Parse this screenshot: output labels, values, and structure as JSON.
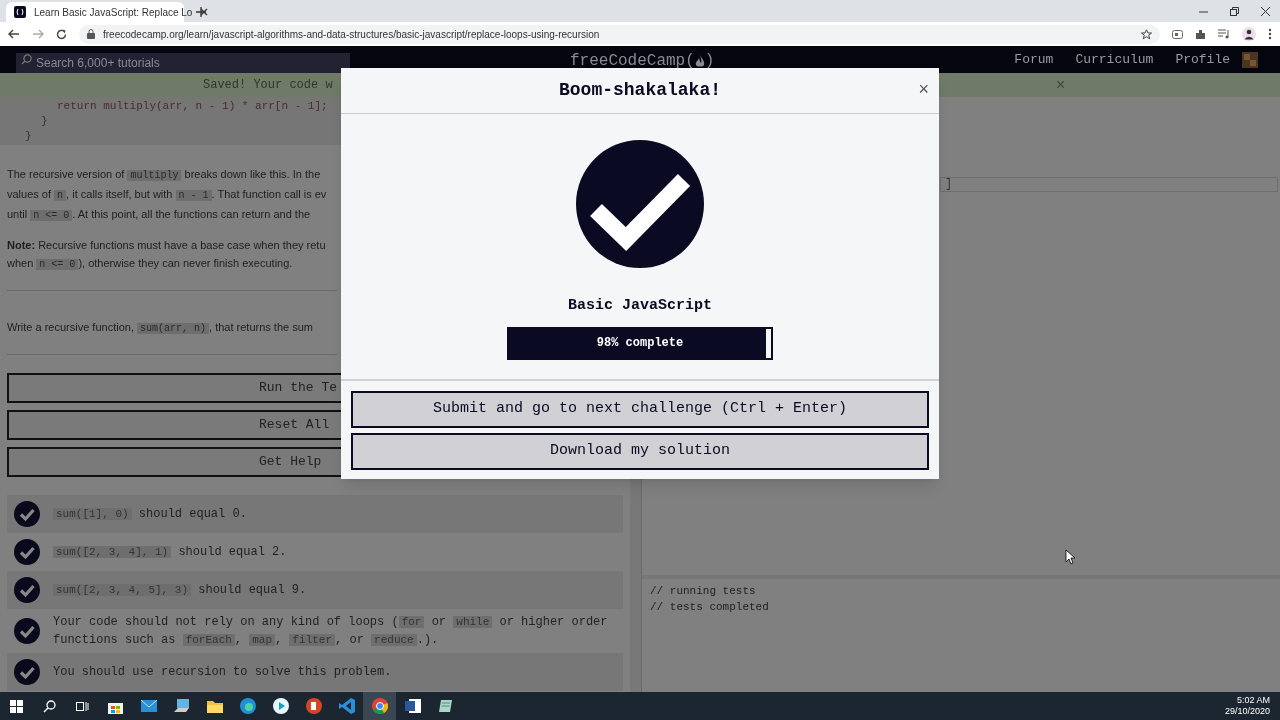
{
  "browser": {
    "tab_title": "Learn Basic JavaScript: Replace Lo",
    "url": "freecodecamp.org/learn/javascript-algorithms-and-data-structures/basic-javascript/replace-loops-using-recursion"
  },
  "navbar": {
    "search_placeholder": "Search 6,000+ tutorials",
    "logo": "freeCodeCamp",
    "logo_open": "(",
    "logo_close": ")",
    "links": [
      "Forum",
      "Curriculum",
      "Profile"
    ]
  },
  "banner": {
    "text": "Saved! Your code w",
    "close": "×"
  },
  "lesson": {
    "code_lines": [
      "return multiply(arr, n - 1) * arr[n - 1];",
      "}",
      "}"
    ],
    "paragraphs": [
      [
        [
          {
            "kind": "text",
            "text": "The recursive version of "
          },
          {
            "kind": "code",
            "text": "multiply"
          },
          {
            "kind": "text",
            "text": " breaks down like this. In the"
          }
        ],
        [
          {
            "kind": "text",
            "text": "values of "
          },
          {
            "kind": "code",
            "text": "n"
          },
          {
            "kind": "text",
            "text": ", it calls itself, but with "
          },
          {
            "kind": "code",
            "text": "n - 1"
          },
          {
            "kind": "text",
            "text": ". That function call is ev"
          }
        ],
        [
          {
            "kind": "text",
            "text": "until "
          },
          {
            "kind": "code",
            "text": "n <= 0"
          },
          {
            "kind": "text",
            "text": ". At this point, all the functions can return and the"
          }
        ]
      ],
      [
        [
          {
            "kind": "bold",
            "text": "Note:"
          },
          {
            "kind": "text",
            "text": " Recursive functions must have a base case when they retu"
          }
        ],
        [
          {
            "kind": "text",
            "text": "when "
          },
          {
            "kind": "code",
            "text": "n <= 0"
          },
          {
            "kind": "text",
            "text": "), otherwise they can never finish executing."
          }
        ]
      ],
      [
        [
          {
            "kind": "text",
            "text": "Write a recursive function, "
          },
          {
            "kind": "code",
            "text": "sum(arr, n)"
          },
          {
            "kind": "text",
            "text": ", that returns the sum"
          }
        ]
      ]
    ],
    "buttons": [
      "Run the Te",
      "Reset All",
      "Get Help"
    ],
    "tests": [
      {
        "passed": true,
        "parts": [
          {
            "kind": "code",
            "text": "sum([1], 0)"
          },
          {
            "kind": "text",
            "text": " should equal 0."
          }
        ]
      },
      {
        "passed": true,
        "parts": [
          {
            "kind": "code",
            "text": "sum([2, 3, 4], 1)"
          },
          {
            "kind": "text",
            "text": " should equal 2."
          }
        ]
      },
      {
        "passed": true,
        "parts": [
          {
            "kind": "code",
            "text": "sum([2, 3, 4, 5], 3)"
          },
          {
            "kind": "text",
            "text": " should equal 9."
          }
        ]
      },
      {
        "passed": true,
        "parts": [
          {
            "kind": "text",
            "text": "Your code should not rely on any kind of loops ("
          },
          {
            "kind": "code",
            "text": "for"
          },
          {
            "kind": "text",
            "text": " or "
          },
          {
            "kind": "code",
            "text": "while"
          },
          {
            "kind": "text",
            "text": " or higher order functions such as "
          },
          {
            "kind": "code",
            "text": "forEach"
          },
          {
            "kind": "text",
            "text": ", "
          },
          {
            "kind": "code",
            "text": "map"
          },
          {
            "kind": "text",
            "text": ", "
          },
          {
            "kind": "code",
            "text": "filter"
          },
          {
            "kind": "text",
            "text": ", or "
          },
          {
            "kind": "code",
            "text": "reduce"
          },
          {
            "kind": "text",
            "text": ".)."
          }
        ]
      },
      {
        "passed": true,
        "parts": [
          {
            "kind": "text",
            "text": "You should use recursion to solve this problem."
          }
        ]
      }
    ]
  },
  "editor": {
    "line_text": "]",
    "console": [
      "// running tests",
      "// tests completed"
    ]
  },
  "modal": {
    "title": "Boom-shakalaka!",
    "close": "×",
    "course": "Basic JavaScript",
    "progress": {
      "level": 0.98,
      "label": "98% complete"
    },
    "buttons": [
      "Submit and go to next challenge (Ctrl + Enter)",
      "Download my solution"
    ]
  },
  "taskbar": {
    "time": "5:02 AM",
    "date": "29/10/2020"
  }
}
